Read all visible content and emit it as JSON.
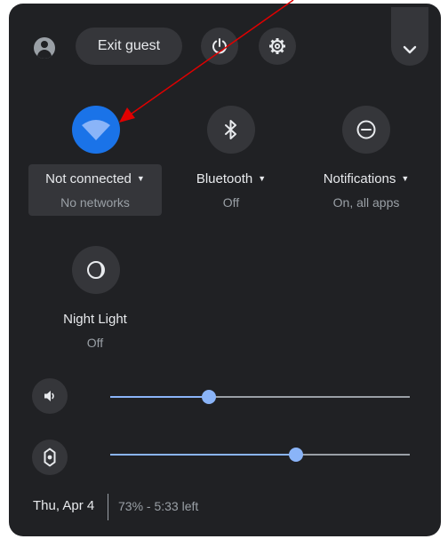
{
  "header": {
    "exit_guest_label": "Exit guest"
  },
  "icons": {
    "avatar": "guest-avatar-icon",
    "power": "power-icon",
    "settings": "gear-icon",
    "collapse": "chevron-down-icon",
    "wifi": "wifi-icon",
    "bluetooth": "bluetooth-icon",
    "notifications": "do-not-disturb-icon",
    "night_light": "night-light-icon",
    "volume": "volume-icon",
    "brightness": "brightness-icon"
  },
  "tiles": {
    "network": {
      "label": "Not connected",
      "status": "No networks",
      "active": true
    },
    "bluetooth": {
      "label": "Bluetooth",
      "status": "Off",
      "active": false
    },
    "notifications": {
      "label": "Notifications",
      "status": "On, all apps",
      "active": false
    },
    "night_light": {
      "label": "Night Light",
      "status": "Off",
      "active": false
    }
  },
  "sliders": {
    "volume": {
      "level": 0.33
    },
    "brightness": {
      "level": 0.62
    }
  },
  "footer": {
    "date": "Thu, Apr 4",
    "battery": "73% - 5:33 left"
  },
  "colors": {
    "panel_bg": "#202124",
    "button_bg": "#35363a",
    "accent_blue": "#1a73e8",
    "slider_blue": "#8ab4f8",
    "annotation_arrow": "#e00000"
  }
}
